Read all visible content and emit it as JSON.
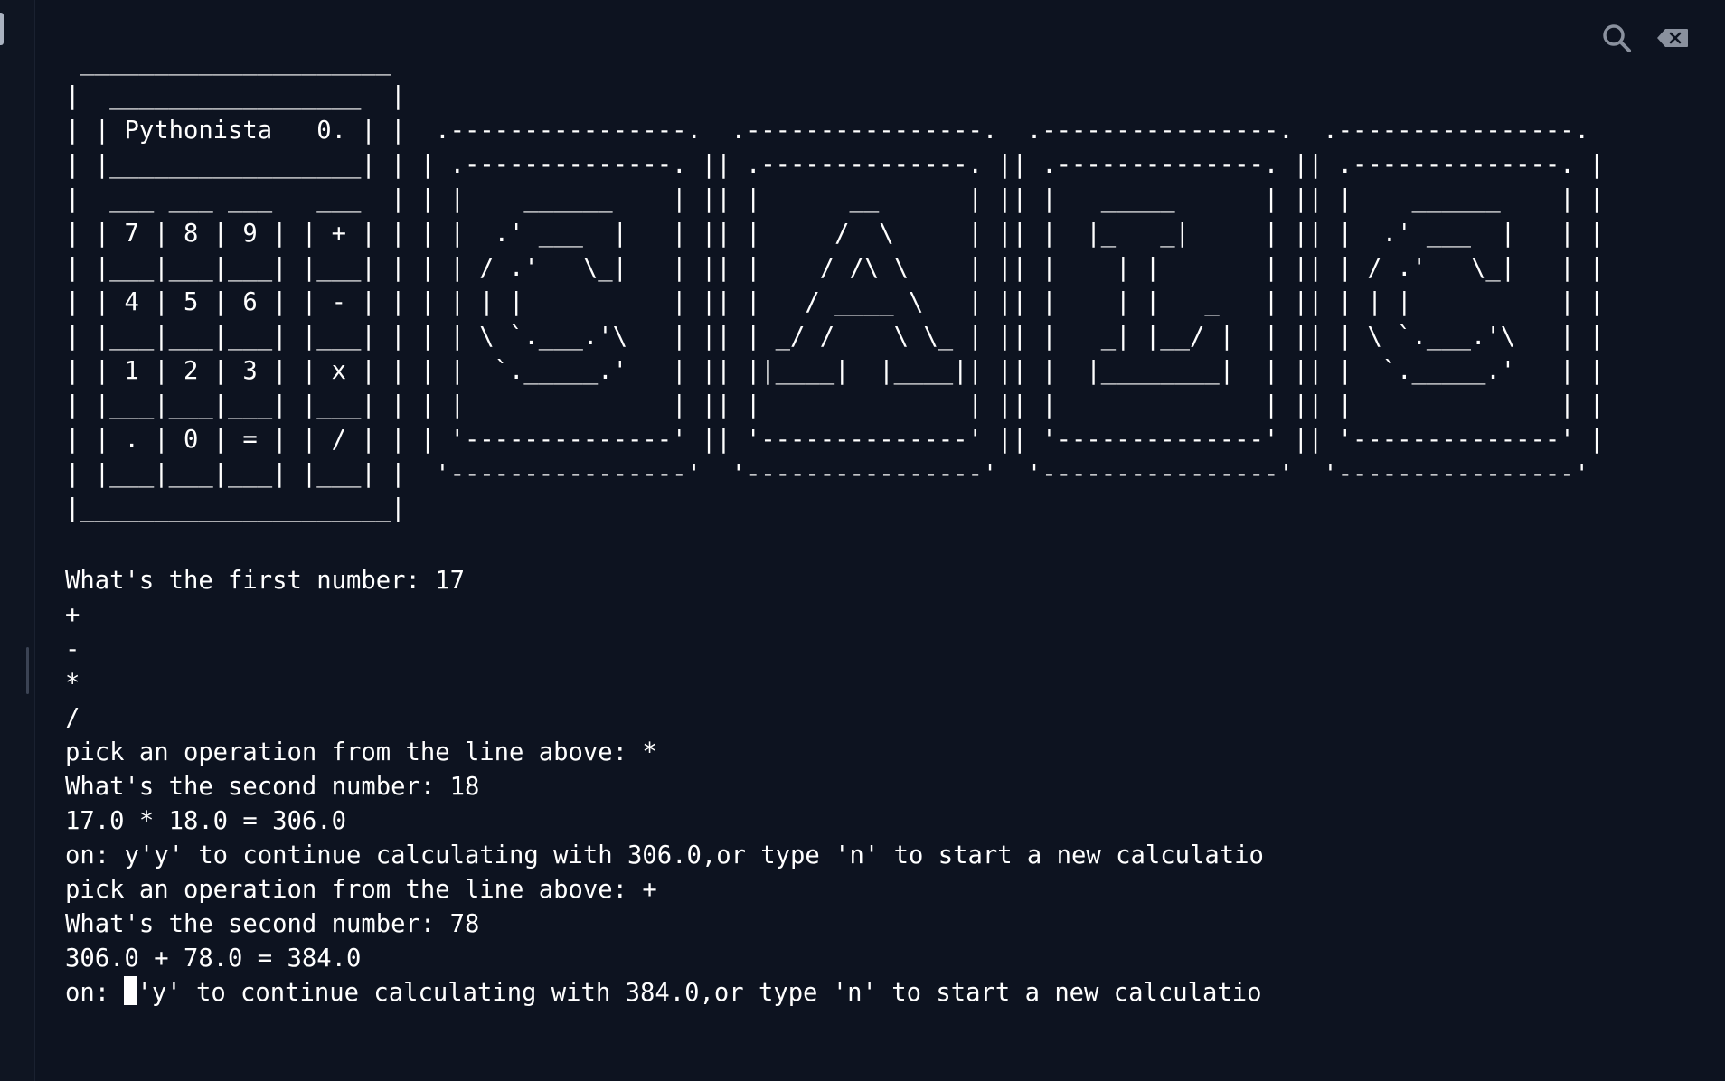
{
  "toolbar": {
    "search_icon": "search-icon",
    "clear_icon": "backspace-icon"
  },
  "ascii_art": " _____________________\n|  _________________  |\n| | Pythonista   0. | |  .----------------.  .----------------.  .----------------.  .----------------.\n| |_________________| | | .--------------. || .--------------. || .--------------. || .--------------. |\n|  ___ ___ ___   ___  | | |    ______    | || |      __      | || |   _____      | || |    ______    | |\n| | 7 | 8 | 9 | | + | | | |  .' ___  |   | || |     /  \\     | || |  |_   _|     | || |  .' ___  |   | |\n| |___|___|___| |___| | | | / .'   \\_|   | || |    / /\\ \\    | || |    | |       | || | / .'   \\_|   | |\n| | 4 | 5 | 6 | | - | | | | | |          | || |   / ____ \\   | || |    | |   _   | || | | |          | |\n| |___|___|___| |___| | | | \\ `.___.'\\   | || | _/ /    \\ \\_ | || |   _| |__/ |  | || | \\ `.___.'\\   | |\n| | 1 | 2 | 3 | | x | | | |  `._____.'   | || ||____|  |____|| || |  |________|  | || |  `._____.'   | |\n| |___|___|___| |___| | | |              | || |              | || |              | || |              | |\n| | . | 0 | = | | / | | | '--------------' || '--------------' || '--------------' || '--------------' |\n| |___|___|___| |___| |  '----------------'  '----------------'  '----------------'  '----------------'\n|_____________________|",
  "lines": [
    "What's the first number: 17",
    "+",
    "-",
    "*",
    "/",
    "pick an operation from the line above: *",
    "What's the second number: 18",
    "17.0 * 18.0 = 306.0",
    "on: y'y' to continue calculating with 306.0,or type 'n' to start a new calculatio",
    "pick an operation from the line above: +",
    "What's the second number: 78",
    "306.0 + 78.0 = 384.0"
  ],
  "prompt": {
    "prefix": "on: ",
    "suffix": "'y' to continue calculating with 384.0,or type 'n' to start a new calculatio"
  }
}
